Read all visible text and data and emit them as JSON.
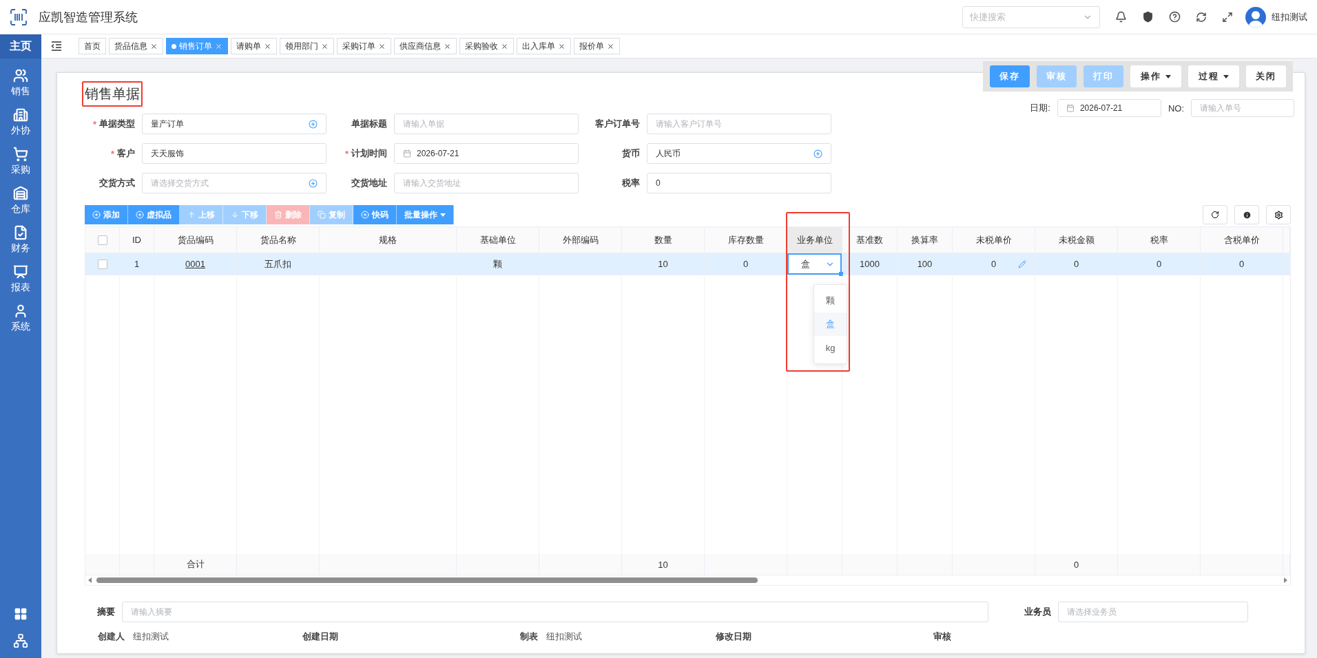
{
  "app": {
    "title": "应凯智造管理系统",
    "search_placeholder": "快捷搜索",
    "user": "纽扣测试"
  },
  "sidebar": {
    "home": "主页",
    "items": [
      {
        "label": "销售"
      },
      {
        "label": "外协"
      },
      {
        "label": "采购"
      },
      {
        "label": "仓库"
      },
      {
        "label": "财务"
      },
      {
        "label": "报表"
      },
      {
        "label": "系统"
      }
    ]
  },
  "tabs": [
    {
      "label": "首页",
      "selected": false,
      "closable": false
    },
    {
      "label": "货品信息",
      "selected": false,
      "closable": true
    },
    {
      "label": "销售订单",
      "selected": true,
      "closable": true
    },
    {
      "label": "请购单",
      "selected": false,
      "closable": true
    },
    {
      "label": "领用部门",
      "selected": false,
      "closable": true
    },
    {
      "label": "采购订单",
      "selected": false,
      "closable": true
    },
    {
      "label": "供应商信息",
      "selected": false,
      "closable": true
    },
    {
      "label": "采购验收",
      "selected": false,
      "closable": true
    },
    {
      "label": "出入库单",
      "selected": false,
      "closable": true
    },
    {
      "label": "报价单",
      "selected": false,
      "closable": true
    }
  ],
  "actions": [
    {
      "label": "保存",
      "kind": "primary",
      "disabled": false
    },
    {
      "label": "审核",
      "kind": "primary",
      "disabled": true
    },
    {
      "label": "打印",
      "kind": "primary",
      "disabled": true
    },
    {
      "label": "操作",
      "kind": "menu",
      "disabled": false
    },
    {
      "label": "过程",
      "kind": "menu",
      "disabled": false
    },
    {
      "label": "关闭",
      "kind": "plain",
      "disabled": false
    }
  ],
  "document": {
    "title": "销售单据",
    "highlighted": true,
    "date_label": "日期:",
    "date": "2026-07-21",
    "no_label": "NO:",
    "no_placeholder": "请输入单号"
  },
  "form": {
    "required_mark": "*",
    "fields": [
      {
        "label": "单据类型",
        "required": true,
        "kind": "select",
        "value": "量产订单"
      },
      {
        "label": "单据标题",
        "required": false,
        "kind": "text",
        "placeholder": "请输入单据"
      },
      {
        "label": "客户订单号",
        "required": false,
        "kind": "text",
        "placeholder": "请输入客户订单号"
      },
      {
        "label": "客户",
        "required": true,
        "kind": "text",
        "value": "天天服饰"
      },
      {
        "label": "计划时间",
        "required": true,
        "kind": "date",
        "value": "2026-07-21"
      },
      {
        "label": "货币",
        "required": false,
        "kind": "select",
        "value": "人民币"
      },
      {
        "label": "交货方式",
        "required": false,
        "kind": "select",
        "placeholder": "请选择交货方式"
      },
      {
        "label": "交货地址",
        "required": false,
        "kind": "text",
        "placeholder": "请输入交货地址"
      },
      {
        "label": "税率",
        "required": false,
        "kind": "text",
        "value": "0"
      }
    ]
  },
  "grid_toolbar": [
    {
      "label": "添加",
      "kind": "add",
      "disabled": false
    },
    {
      "label": "虚拟品",
      "kind": "add",
      "disabled": false
    },
    {
      "label": "上移",
      "kind": "up",
      "disabled": true
    },
    {
      "label": "下移",
      "kind": "down",
      "disabled": true
    },
    {
      "label": "删除",
      "kind": "delete",
      "disabled": true
    },
    {
      "label": "复制",
      "kind": "copy",
      "disabled": true
    },
    {
      "label": "快码",
      "kind": "add",
      "disabled": false
    },
    {
      "label": "批量操作",
      "kind": "menu",
      "disabled": false
    }
  ],
  "table": {
    "header_checked": false,
    "columns": [
      {
        "label": "ID",
        "kind": "text"
      },
      {
        "label": "货品编码",
        "kind": "link",
        "total": "合计"
      },
      {
        "label": "货品名称",
        "kind": "text"
      },
      {
        "label": "规格",
        "kind": "text"
      },
      {
        "label": "基础单位",
        "kind": "text"
      },
      {
        "label": "外部编码",
        "kind": "text"
      },
      {
        "label": "数量",
        "kind": "text",
        "total": "10"
      },
      {
        "label": "库存数量",
        "kind": "text"
      },
      {
        "label": "业务单位",
        "kind": "unit"
      },
      {
        "label": "基准数",
        "kind": "text"
      },
      {
        "label": "换算率",
        "kind": "text"
      },
      {
        "label": "未税单价",
        "kind": "price"
      },
      {
        "label": "未税金额",
        "kind": "text",
        "total": "0"
      },
      {
        "label": "税率",
        "kind": "text"
      },
      {
        "label": "含税单价",
        "kind": "text"
      }
    ],
    "rows": [
      {
        "selected": true,
        "checked": false,
        "cells": [
          {
            "text": "1"
          },
          {
            "text": "0001"
          },
          {
            "text": "五爪扣"
          },
          {},
          {
            "text": "颗"
          },
          {},
          {
            "text": "10"
          },
          {
            "text": "0"
          },
          {
            "text": "盒"
          },
          {
            "text": "1000"
          },
          {
            "text": "100"
          },
          {
            "text": "0"
          },
          {
            "text": "0"
          },
          {
            "text": "0"
          },
          {
            "text": "0"
          }
        ],
        "unit_dropdown": {
          "open": true,
          "highlighted": true,
          "options": [
            {
              "label": "颗",
              "selected": false
            },
            {
              "label": "盒",
              "selected": true
            },
            {
              "label": "kg",
              "selected": false
            }
          ]
        }
      }
    ]
  },
  "bottom": {
    "summary_label": "摘要",
    "summary_placeholder": "请输入摘要",
    "clerk_label": "业务员",
    "clerk_placeholder": "请选择业务员",
    "meta": [
      {
        "label": "创建人",
        "value": "纽扣测试"
      },
      {
        "label": "创建日期"
      },
      {
        "label": "制表",
        "value": "纽扣测试"
      },
      {
        "label": "修改日期"
      },
      {
        "label": "审核"
      }
    ]
  }
}
